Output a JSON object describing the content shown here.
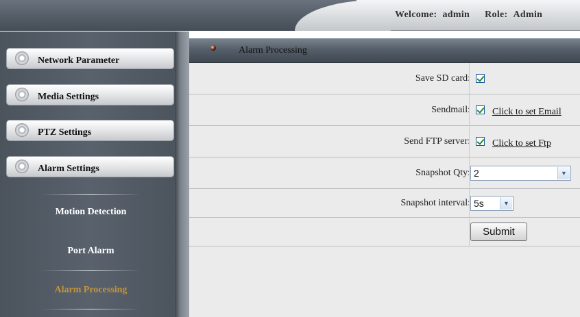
{
  "header": {
    "welcome_label": "Welcome:",
    "user": "admin",
    "role_label": "Role:",
    "role": "Admin"
  },
  "sidebar": {
    "menus": [
      {
        "label": "Network Parameter",
        "icon": "gear-icon"
      },
      {
        "label": "Media Settings",
        "icon": "gear-icon"
      },
      {
        "label": "PTZ Settings",
        "icon": "gear-icon"
      },
      {
        "label": "Alarm Settings",
        "icon": "gear-icon"
      }
    ],
    "submenu": [
      {
        "label": "Motion Detection",
        "active": false
      },
      {
        "label": "Port Alarm",
        "active": false
      },
      {
        "label": "Alarm Processing",
        "active": true
      }
    ],
    "active_color": "#c4943c"
  },
  "panel": {
    "title": "Alarm Processing",
    "fields": {
      "save_sd_card": {
        "label": "Save SD card:",
        "checked": true
      },
      "sendmail": {
        "label": "Sendmail:",
        "checked": true,
        "link": "Click to set Email"
      },
      "send_ftp": {
        "label": "Send FTP server:",
        "checked": true,
        "link": "Click to set Ftp"
      },
      "snapshot_qty": {
        "label": "Snapshot Qty:",
        "value": "2"
      },
      "snapshot_interval": {
        "label": "Snapshot interval:",
        "value": "5s"
      }
    },
    "submit_label": "Submit"
  }
}
